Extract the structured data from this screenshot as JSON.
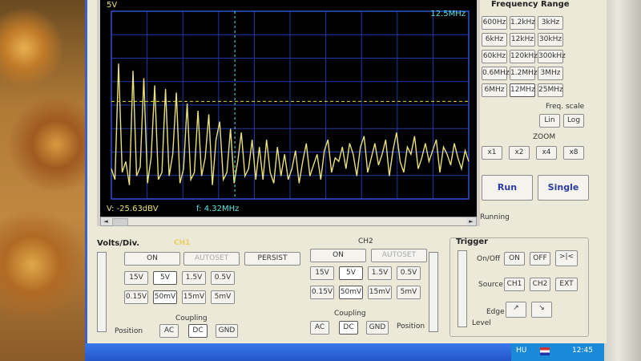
{
  "screen": {
    "voltage_label": "5V",
    "freq_label": "12.5MHz",
    "readout_v": "V: -25.63dBV",
    "readout_f": "f: 4.32MHz"
  },
  "frequency_range": {
    "title": "Frequency Range",
    "buttons": [
      "600Hz",
      "1.2kHz",
      "3kHz",
      "6kHz",
      "12kHz",
      "30kHz",
      "60kHz",
      "120kHz",
      "300kHz",
      "0.6MHz",
      "1.2MHz",
      "3MHz",
      "6MHz",
      "12MHz",
      "25MHz"
    ],
    "selected": "12MHz",
    "freq_scale_label": "Freq. scale",
    "scale_buttons": [
      "Lin",
      "Log"
    ],
    "zoom_label": "ZOOM",
    "zoom_buttons": [
      "x1",
      "x2",
      "x4",
      "x8"
    ],
    "run_label": "Run",
    "single_label": "Single",
    "status": "Running"
  },
  "volts_div": {
    "title": "Volts/Div.",
    "ch1_label": "CH1",
    "ch1": {
      "on": "ON",
      "autoset": "AUTOSET",
      "persist": "PERSIST",
      "row1": [
        "15V",
        "5V",
        "1.5V",
        "0.5V"
      ],
      "row2": [
        "0.15V",
        "50mV",
        "15mV",
        "5mV"
      ]
    },
    "ch2_label": "CH2",
    "ch2": {
      "on": "ON",
      "autoset": "AUTOSET",
      "row1": [
        "15V",
        "5V",
        "1.5V",
        "0.5V"
      ],
      "row2": [
        "0.15V",
        "50mV",
        "15mV",
        "5mV"
      ]
    },
    "coupling_label": "Coupling",
    "coupling_buttons": [
      "AC",
      "DC",
      "GND"
    ],
    "position_label": "Position"
  },
  "trigger": {
    "title": "Trigger",
    "onoff_label": "On/Off",
    "on": "ON",
    "off": "OFF",
    "source_label": "Source",
    "sources": [
      "CH1",
      "CH2",
      "EXT"
    ],
    "edge_label": "Edge",
    "level_label": "Level"
  },
  "taskbar": {
    "lang": "HU",
    "time": "12:45"
  },
  "chart_data": {
    "type": "line",
    "xlabel": "",
    "ylabel": "",
    "x_range": [
      0,
      12.5
    ],
    "cursor_level_fraction": 0.52,
    "cursor_freq_mhz": 4.32,
    "y": [
      0.14,
      0.08,
      0.72,
      0.12,
      0.18,
      0.05,
      0.68,
      0.1,
      0.15,
      0.64,
      0.06,
      0.2,
      0.6,
      0.08,
      0.12,
      0.58,
      0.1,
      0.22,
      0.56,
      0.06,
      0.14,
      0.5,
      0.08,
      0.12,
      0.46,
      0.1,
      0.2,
      0.44,
      0.05,
      0.3,
      0.4,
      0.08,
      0.12,
      0.36,
      0.06,
      0.18,
      0.34,
      0.1,
      0.14,
      0.3,
      0.08,
      0.26,
      0.08,
      0.3,
      0.12,
      0.06,
      0.26,
      0.1,
      0.22,
      0.08,
      0.14,
      0.24,
      0.06,
      0.18,
      0.28,
      0.1,
      0.16,
      0.22,
      0.08,
      0.24,
      0.3,
      0.12,
      0.2,
      0.18,
      0.26,
      0.14,
      0.28,
      0.22,
      0.1,
      0.26,
      0.32,
      0.12,
      0.2,
      0.28,
      0.16,
      0.22,
      0.3,
      0.1,
      0.24,
      0.34,
      0.18,
      0.12,
      0.26,
      0.22,
      0.32,
      0.14,
      0.2,
      0.28,
      0.18,
      0.24,
      0.3,
      0.12,
      0.26,
      0.22,
      0.16,
      0.28,
      0.2,
      0.14,
      0.24,
      0.18
    ]
  }
}
